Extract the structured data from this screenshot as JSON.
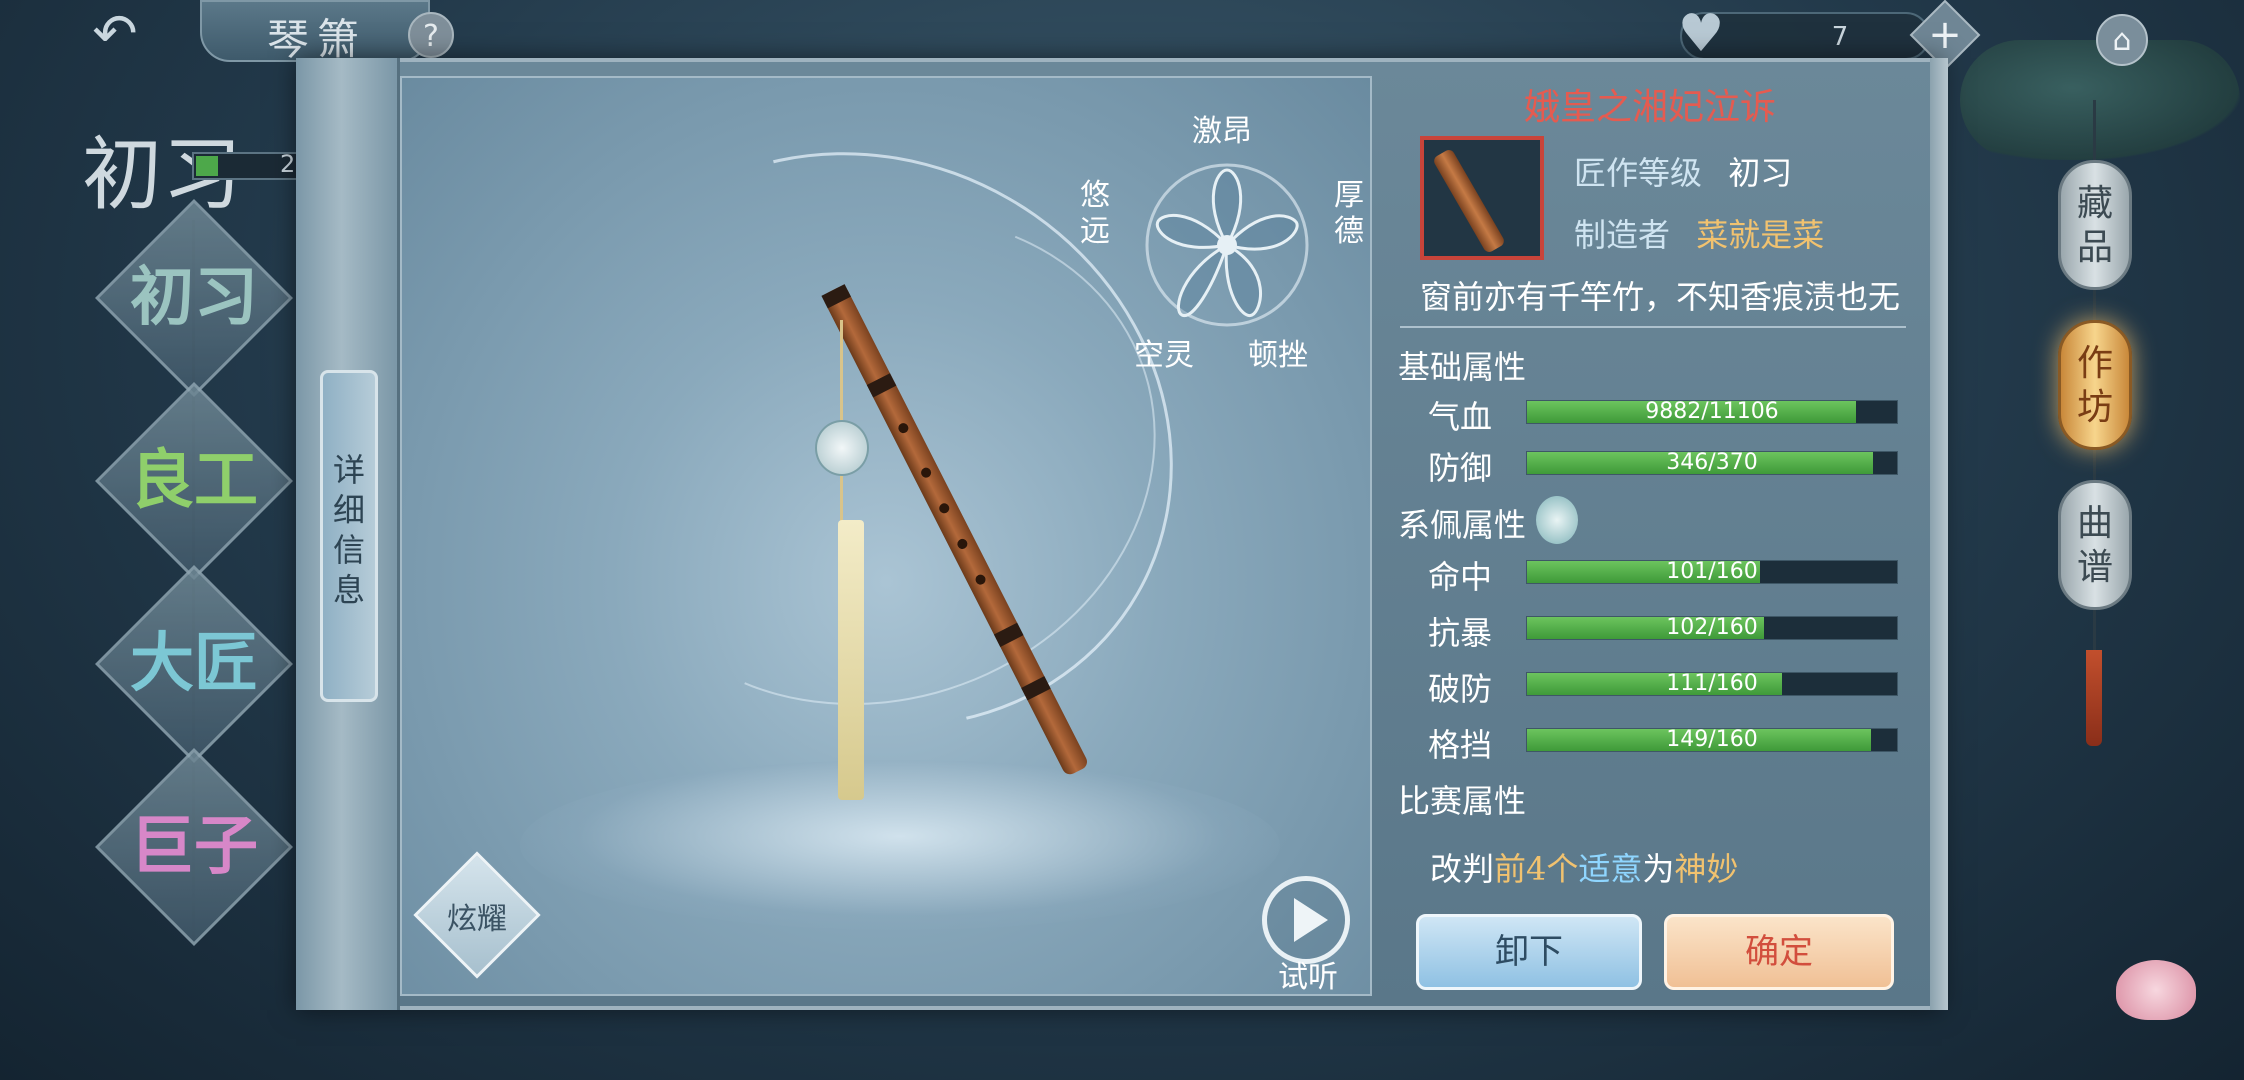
{
  "topbar": {
    "back_icon": "back-arrow-icon",
    "title": "琴箫",
    "help_label": "?",
    "hp_value": "7",
    "plus_label": "+",
    "home_icon": "home-icon"
  },
  "left": {
    "rank": "初习",
    "exp_text": "2",
    "levels": [
      {
        "label": "初习",
        "color": "#9bc4c0"
      },
      {
        "label": "良工",
        "color": "#8fcf6b"
      },
      {
        "label": "大匠",
        "color": "#7cc7d4"
      },
      {
        "label": "巨子",
        "color": "#d787c8"
      }
    ]
  },
  "panel": {
    "detail_tab": "详细信息",
    "radar": {
      "top": "激昂",
      "left": "悠远",
      "right": "厚德",
      "bottom_left": "空灵",
      "bottom_right": "顿挫"
    },
    "showoff_label": "炫耀",
    "listen_label": "试听"
  },
  "item": {
    "name": "娥皇之湘妃泣诉",
    "craft_level_label": "匠作等级",
    "craft_level_value": "初习",
    "maker_label": "制造者",
    "maker_value": "菜就是菜",
    "quote": "窗前亦有千竿竹，不知香痕渍也无",
    "base_section": "基础属性",
    "base_stats": [
      {
        "label": "气血",
        "text": "9882/11106",
        "ratio": 0.89
      },
      {
        "label": "防御",
        "text": "346/370",
        "ratio": 0.935
      }
    ],
    "pendant_section": "系佩属性",
    "pendant_stats": [
      {
        "label": "命中",
        "text": "101/160",
        "ratio": 0.63
      },
      {
        "label": "抗暴",
        "text": "102/160",
        "ratio": 0.64
      },
      {
        "label": "破防",
        "text": "111/160",
        "ratio": 0.69
      },
      {
        "label": "格挡",
        "text": "149/160",
        "ratio": 0.93
      }
    ],
    "match_section": "比赛属性",
    "rule": {
      "p1": "改判",
      "p2": "前4个",
      "p3": "适意",
      "p4": "为",
      "p5": "神妙"
    },
    "unequip_label": "卸下",
    "confirm_label": "确定"
  },
  "lanterns": [
    {
      "label": "藏品",
      "active": false
    },
    {
      "label": "作坊",
      "active": true
    },
    {
      "label": "曲谱",
      "active": false
    }
  ]
}
